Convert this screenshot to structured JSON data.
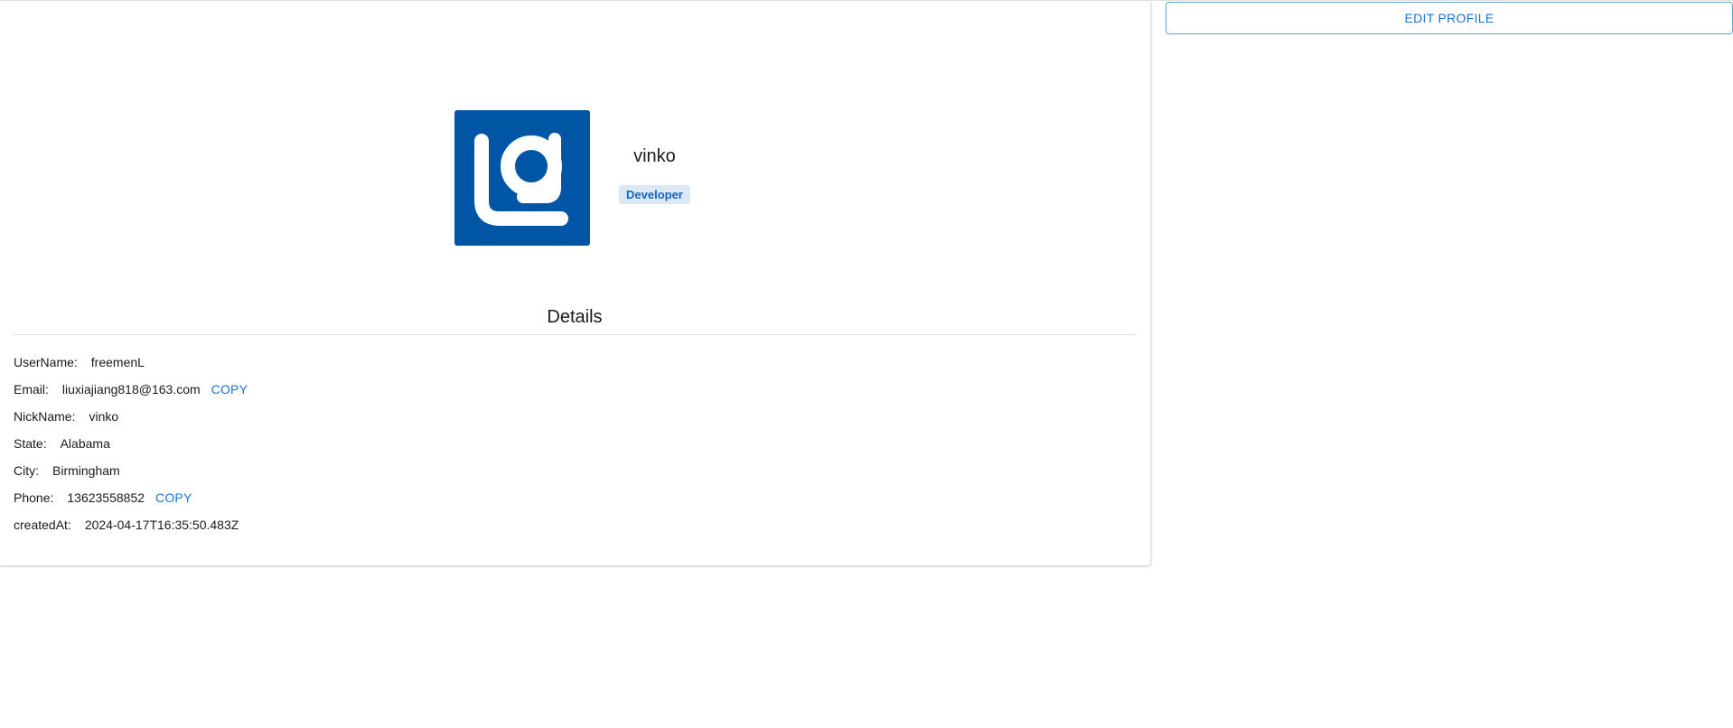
{
  "profile": {
    "display_name": "vinko",
    "role": "Developer",
    "avatar_icon": "brand-logo-icon",
    "accent_color": "#0055a5"
  },
  "actions": {
    "edit_label": "EDIT PROFILE"
  },
  "details": {
    "title": "Details",
    "copy_label": "COPY",
    "rows": [
      {
        "label": "UserName:",
        "value": "freemenL",
        "copyable": false
      },
      {
        "label": "Email:",
        "value": "liuxiajiang818@163.com",
        "copyable": true
      },
      {
        "label": "NickName:",
        "value": "vinko",
        "copyable": false
      },
      {
        "label": "State:",
        "value": "Alabama",
        "copyable": false
      },
      {
        "label": "City:",
        "value": "Birmingham",
        "copyable": false
      },
      {
        "label": "Phone:",
        "value": "13623558852",
        "copyable": true
      },
      {
        "label": "createdAt:",
        "value": "2024-04-17T16:35:50.483Z",
        "copyable": false
      }
    ]
  }
}
